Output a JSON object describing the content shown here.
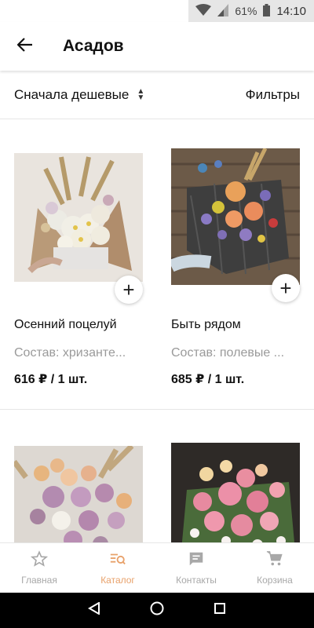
{
  "status_bar": {
    "battery_percent": "61%",
    "time": "14:10"
  },
  "app_bar": {
    "title": "Асадов"
  },
  "sort_bar": {
    "sort_label": "Сначала дешевые",
    "filters_label": "Фильтры"
  },
  "products": [
    {
      "name": "Осенний поцелуй",
      "description": "Состав: хризанте...",
      "price": "616 ₽ / 1 шт."
    },
    {
      "name": "Быть рядом",
      "description": "Состав: полевые ...",
      "price": "685 ₽ / 1 шт."
    },
    {
      "name": "",
      "description": "",
      "price": ""
    },
    {
      "name": "",
      "description": "",
      "price": ""
    }
  ],
  "tab_bar": {
    "tabs": [
      {
        "label": "Главная",
        "icon": "star-icon"
      },
      {
        "label": "Каталог",
        "icon": "catalog-search-icon",
        "active": true
      },
      {
        "label": "Контакты",
        "icon": "chat-icon"
      },
      {
        "label": "Корзина",
        "icon": "cart-icon"
      }
    ]
  },
  "colors": {
    "accent": "#e8a16a",
    "muted": "#a8a8a8"
  }
}
